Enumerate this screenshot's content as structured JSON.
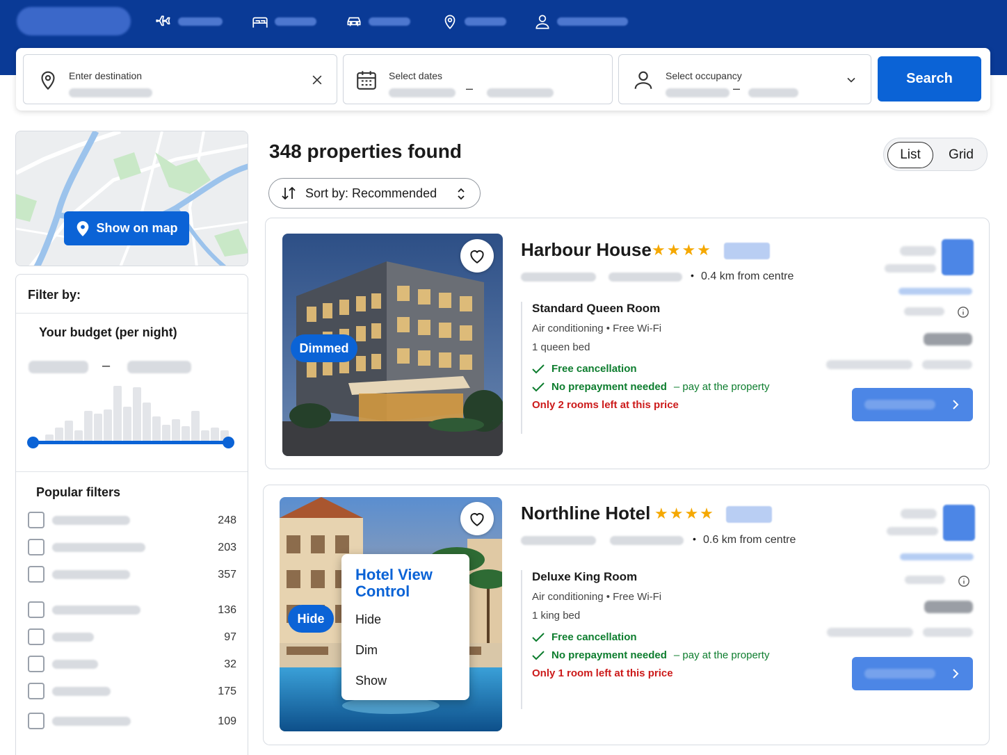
{
  "search": {
    "destination_label": "Enter destination",
    "dates_label": "Select dates",
    "dates_separator": "–",
    "occupancy_label": "Select occupancy",
    "occupancy_separator": "–",
    "search_button": "Search"
  },
  "map": {
    "button_label": "Show on map"
  },
  "filters": {
    "title": "Filter by:",
    "budget_title": "Your budget (per night)",
    "budget_separator": "–",
    "histogram": [
      0.12,
      0.25,
      0.38,
      0.2,
      0.55,
      0.5,
      0.58,
      1.0,
      0.62,
      0.98,
      0.7,
      0.45,
      0.3,
      0.4,
      0.28,
      0.55,
      0.2,
      0.25,
      0.2
    ],
    "popular_title": "Popular filters",
    "popular": [
      {
        "count": "248"
      },
      {
        "count": "203"
      },
      {
        "count": "357"
      },
      {
        "count": "136"
      },
      {
        "count": "97"
      },
      {
        "count": "32"
      },
      {
        "count": "175"
      },
      {
        "count": "109"
      }
    ]
  },
  "results": {
    "count_title": "348 properties found",
    "sort_label": "Sort by: Recommended",
    "view_list": "List",
    "view_grid": "Grid"
  },
  "properties": [
    {
      "name": "Harbour House",
      "stars": "★★★★",
      "distance": "0.4 km from centre",
      "badge": "Dimmed",
      "room_name": "Standard Queen Room",
      "amenities": "Air conditioning  •  Free Wi-Fi",
      "bed": "1 queen bed",
      "free_cancellation": "Free cancellation",
      "no_prepayment": "No prepayment needed",
      "no_prepayment_note": "– pay at the property",
      "scarcity": "Only 2 rooms left at this price"
    },
    {
      "name": "Northline Hotel",
      "stars": "★★★★",
      "distance": "0.6 km from centre",
      "badge": "Hide",
      "room_name": "Deluxe King Room",
      "amenities": "Air conditioning  •  Free Wi-Fi",
      "bed": "1 king bed",
      "free_cancellation": "Free cancellation",
      "no_prepayment": "No prepayment needed",
      "no_prepayment_note": "– pay at the property",
      "scarcity": "Only 1 room left at this price"
    }
  ],
  "view_control": {
    "title": "Hotel View Control",
    "options": [
      "Hide",
      "Dim",
      "Show"
    ]
  },
  "colors": {
    "topbar": "#0a3a96",
    "accent": "#0b63d6",
    "success": "#0d7d2e",
    "warning": "#cc1a1a",
    "star": "#f5a800"
  },
  "icons": {
    "nav": [
      "plane-icon",
      "bed-icon",
      "car-icon",
      "location-pin-icon",
      "user-icon"
    ],
    "search": [
      "location-pin-icon",
      "calendar-icon",
      "user-icon",
      "chevron-down-icon",
      "close-icon"
    ]
  }
}
